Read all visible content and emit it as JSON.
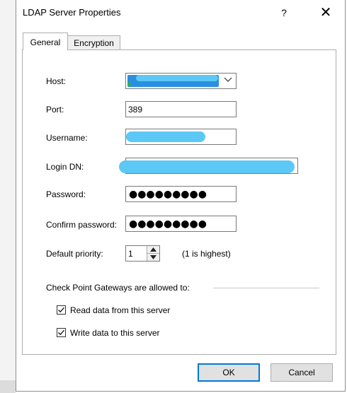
{
  "window": {
    "title": "LDAP Server Properties",
    "help_glyph": "?",
    "close_glyph": "✕"
  },
  "tabs": [
    {
      "label": "General",
      "active": true
    },
    {
      "label": "Encryption",
      "active": false
    }
  ],
  "general": {
    "host": {
      "label": "Host:",
      "value": ""
    },
    "port": {
      "label": "Port:",
      "value": "389"
    },
    "username": {
      "label": "Username:",
      "value": ""
    },
    "login_dn": {
      "label": "Login DN:",
      "value": ""
    },
    "password": {
      "label": "Password:",
      "value": "●●●●●●●●●"
    },
    "confirm_password": {
      "label": "Confirm password:",
      "value": "●●●●●●●●●"
    },
    "default_priority": {
      "label": "Default priority:",
      "value": "1",
      "hint": "(1 is highest)"
    },
    "gateways": {
      "label": "Check Point Gateways are allowed to:",
      "read": {
        "label": "Read data from this server",
        "checked": true
      },
      "write": {
        "label": "Write data to this server",
        "checked": true
      }
    }
  },
  "buttons": {
    "ok": "OK",
    "cancel": "Cancel"
  },
  "colors": {
    "redaction": "#5cc8f5",
    "accent": "#0078d7"
  }
}
